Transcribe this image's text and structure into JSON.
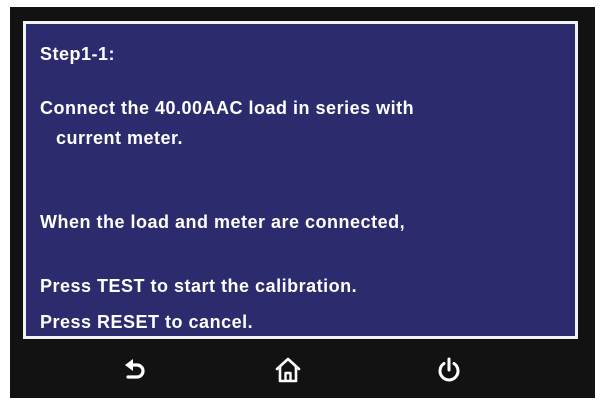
{
  "screen": {
    "step_label": "Step1-1:",
    "instruction_line1": "Connect the 40.00AAC load in series with",
    "instruction_line2": "current meter.",
    "connected_text": "When the load and meter are connected,",
    "press_test_text": "Press TEST to start the calibration.",
    "press_reset_text": "Press RESET to cancel."
  },
  "nav": {
    "back_icon": "back-arrow-icon",
    "home_icon": "home-icon",
    "power_icon": "power-icon"
  },
  "colors": {
    "panel_background": "#2b2b6e",
    "frame_background": "#121212",
    "text": "#ffffff"
  }
}
